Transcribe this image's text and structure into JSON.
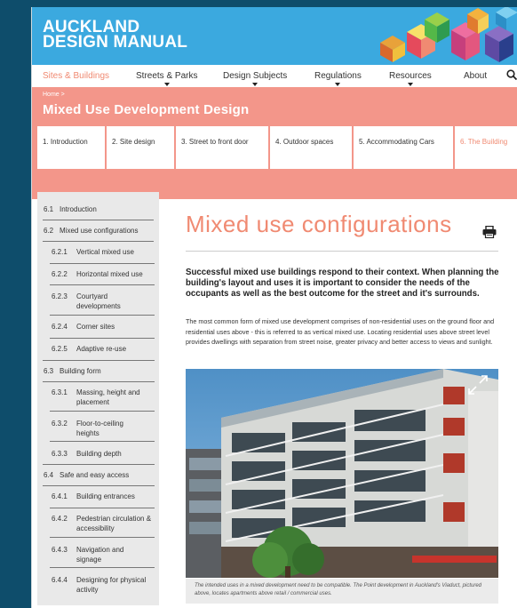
{
  "header": {
    "logo_line1": "AUCKLAND",
    "logo_line2": "DESIGN MANUAL"
  },
  "nav": {
    "items": [
      {
        "label": "Sites & Buildings"
      },
      {
        "label": "Streets & Parks"
      },
      {
        "label": "Design Subjects"
      },
      {
        "label": "Regulations"
      },
      {
        "label": "Resources"
      },
      {
        "label": "About"
      }
    ]
  },
  "title_band": {
    "breadcrumb": "Home >",
    "title": "Mixed Use Development Design"
  },
  "tabs": [
    {
      "label": "1. Introduction"
    },
    {
      "label": "2. Site design"
    },
    {
      "label": "3. Street to front door"
    },
    {
      "label": "4. Outdoor spaces"
    },
    {
      "label": "5. Accommodating Cars"
    },
    {
      "label": "6. The Building"
    }
  ],
  "sidebar": {
    "items": [
      {
        "num": "6.1",
        "label": "Introduction"
      },
      {
        "num": "6.2",
        "label": "Mixed use configurations"
      },
      {
        "num": "6.2.1",
        "label": "Vertical mixed use"
      },
      {
        "num": "6.2.2",
        "label": "Horizontal mixed use"
      },
      {
        "num": "6.2.3",
        "label": "Courtyard developments"
      },
      {
        "num": "6.2.4",
        "label": "Corner sites"
      },
      {
        "num": "6.2.5",
        "label": "Adaptive re-use"
      },
      {
        "num": "6.3",
        "label": "Building form"
      },
      {
        "num": "6.3.1",
        "label": "Massing, height and placement"
      },
      {
        "num": "6.3.2",
        "label": "Floor-to-ceiling heights"
      },
      {
        "num": "6.3.3",
        "label": "Building depth"
      },
      {
        "num": "6.4",
        "label": "Safe and easy access"
      },
      {
        "num": "6.4.1",
        "label": "Building entrances"
      },
      {
        "num": "6.4.2",
        "label": "Pedestrian circulation & accessibility"
      },
      {
        "num": "6.4.3",
        "label": "Navigation and signage"
      },
      {
        "num": "6.4.4",
        "label": "Designing for physical activity"
      }
    ]
  },
  "main": {
    "heading": "Mixed use configurations",
    "lead": "Successful mixed use buildings respond to their context. When planning the building's layout and uses it is important to consider the needs of the occupants as well as the best outcome for the street and it's surrounds.",
    "body": "The most common form of mixed use development comprises of non-residential uses on the ground floor and residential uses above - this is referred to as vertical mixed use. Locating residential uses above street level provides dwellings with separation from street noise, greater privacy and better access to views and sunlight.",
    "caption": "The intended uses in a mixed development need to be compatible. The Point development in Auckland's Viaduct, pictured above, locates apartments above retail / commercial uses."
  },
  "colors": {
    "accent": "#f08a72",
    "band": "#f3968a",
    "header": "#3ba9df",
    "background": "#0e4d6b"
  }
}
